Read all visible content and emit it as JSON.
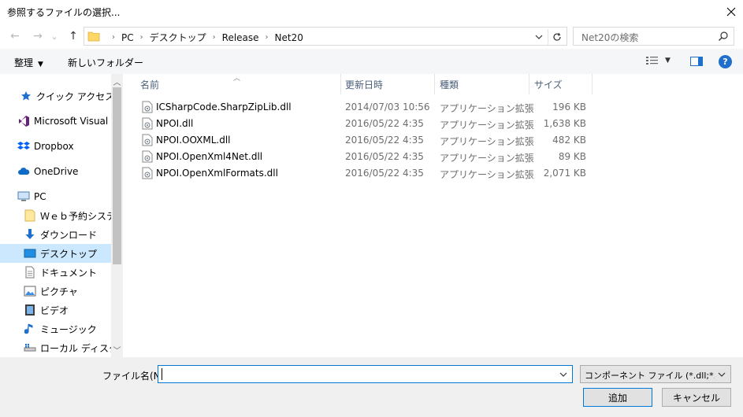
{
  "window": {
    "title": "参照するファイルの選択..."
  },
  "nav": {
    "back": "←",
    "forward": "→",
    "recent": "⌄",
    "up": "↑",
    "breadcrumbs": [
      "PC",
      "デスクトップ",
      "Release",
      "Net20"
    ],
    "search_placeholder": "Net20の検索"
  },
  "toolbar": {
    "organize": "整理",
    "new_folder": "新しいフォルダー"
  },
  "sidebar": {
    "items": [
      {
        "label": "クイック アクセス",
        "icon": "star-icon"
      },
      {
        "label": "Microsoft Visual S",
        "icon": "visual-studio-icon"
      },
      {
        "label": "Dropbox",
        "icon": "dropbox-icon"
      },
      {
        "label": "OneDrive",
        "icon": "cloud-icon"
      },
      {
        "label": "PC",
        "icon": "computer-icon"
      },
      {
        "label": "Ｗｅｂ予約システ",
        "icon": "folder-icon"
      },
      {
        "label": "ダウンロード",
        "icon": "download-icon"
      },
      {
        "label": "デスクトップ",
        "icon": "desktop-icon"
      },
      {
        "label": "ドキュメント",
        "icon": "document-icon"
      },
      {
        "label": "ピクチャ",
        "icon": "picture-icon"
      },
      {
        "label": "ビデオ",
        "icon": "video-icon"
      },
      {
        "label": "ミュージック",
        "icon": "music-icon"
      },
      {
        "label": "ローカル ディスク (C",
        "icon": "drive-icon"
      }
    ]
  },
  "columns": {
    "name": "名前",
    "modified": "更新日時",
    "type": "種類",
    "size": "サイズ"
  },
  "files": [
    {
      "name": "ICSharpCode.SharpZipLib.dll",
      "modified": "2014/07/03 10:56",
      "type": "アプリケーション拡張",
      "size": "196 KB"
    },
    {
      "name": "NPOI.dll",
      "modified": "2016/05/22 4:35",
      "type": "アプリケーション拡張",
      "size": "1,638 KB"
    },
    {
      "name": "NPOI.OOXML.dll",
      "modified": "2016/05/22 4:35",
      "type": "アプリケーション拡張",
      "size": "482 KB"
    },
    {
      "name": "NPOI.OpenXml4Net.dll",
      "modified": "2016/05/22 4:35",
      "type": "アプリケーション拡張",
      "size": "89 KB"
    },
    {
      "name": "NPOI.OpenXmlFormats.dll",
      "modified": "2016/05/22 4:35",
      "type": "アプリケーション拡張",
      "size": "2,071 KB"
    }
  ],
  "bottom": {
    "filename_label": "ファイル名(N):",
    "filename_value": "",
    "filter": "コンポーネント ファイル (*.dll;*.tlb;*.o",
    "ok": "追加",
    "cancel": "キャンセル"
  },
  "colors": {
    "accent": "#0078d7",
    "selection": "#cce8ff",
    "header_text": "#4c607a"
  }
}
